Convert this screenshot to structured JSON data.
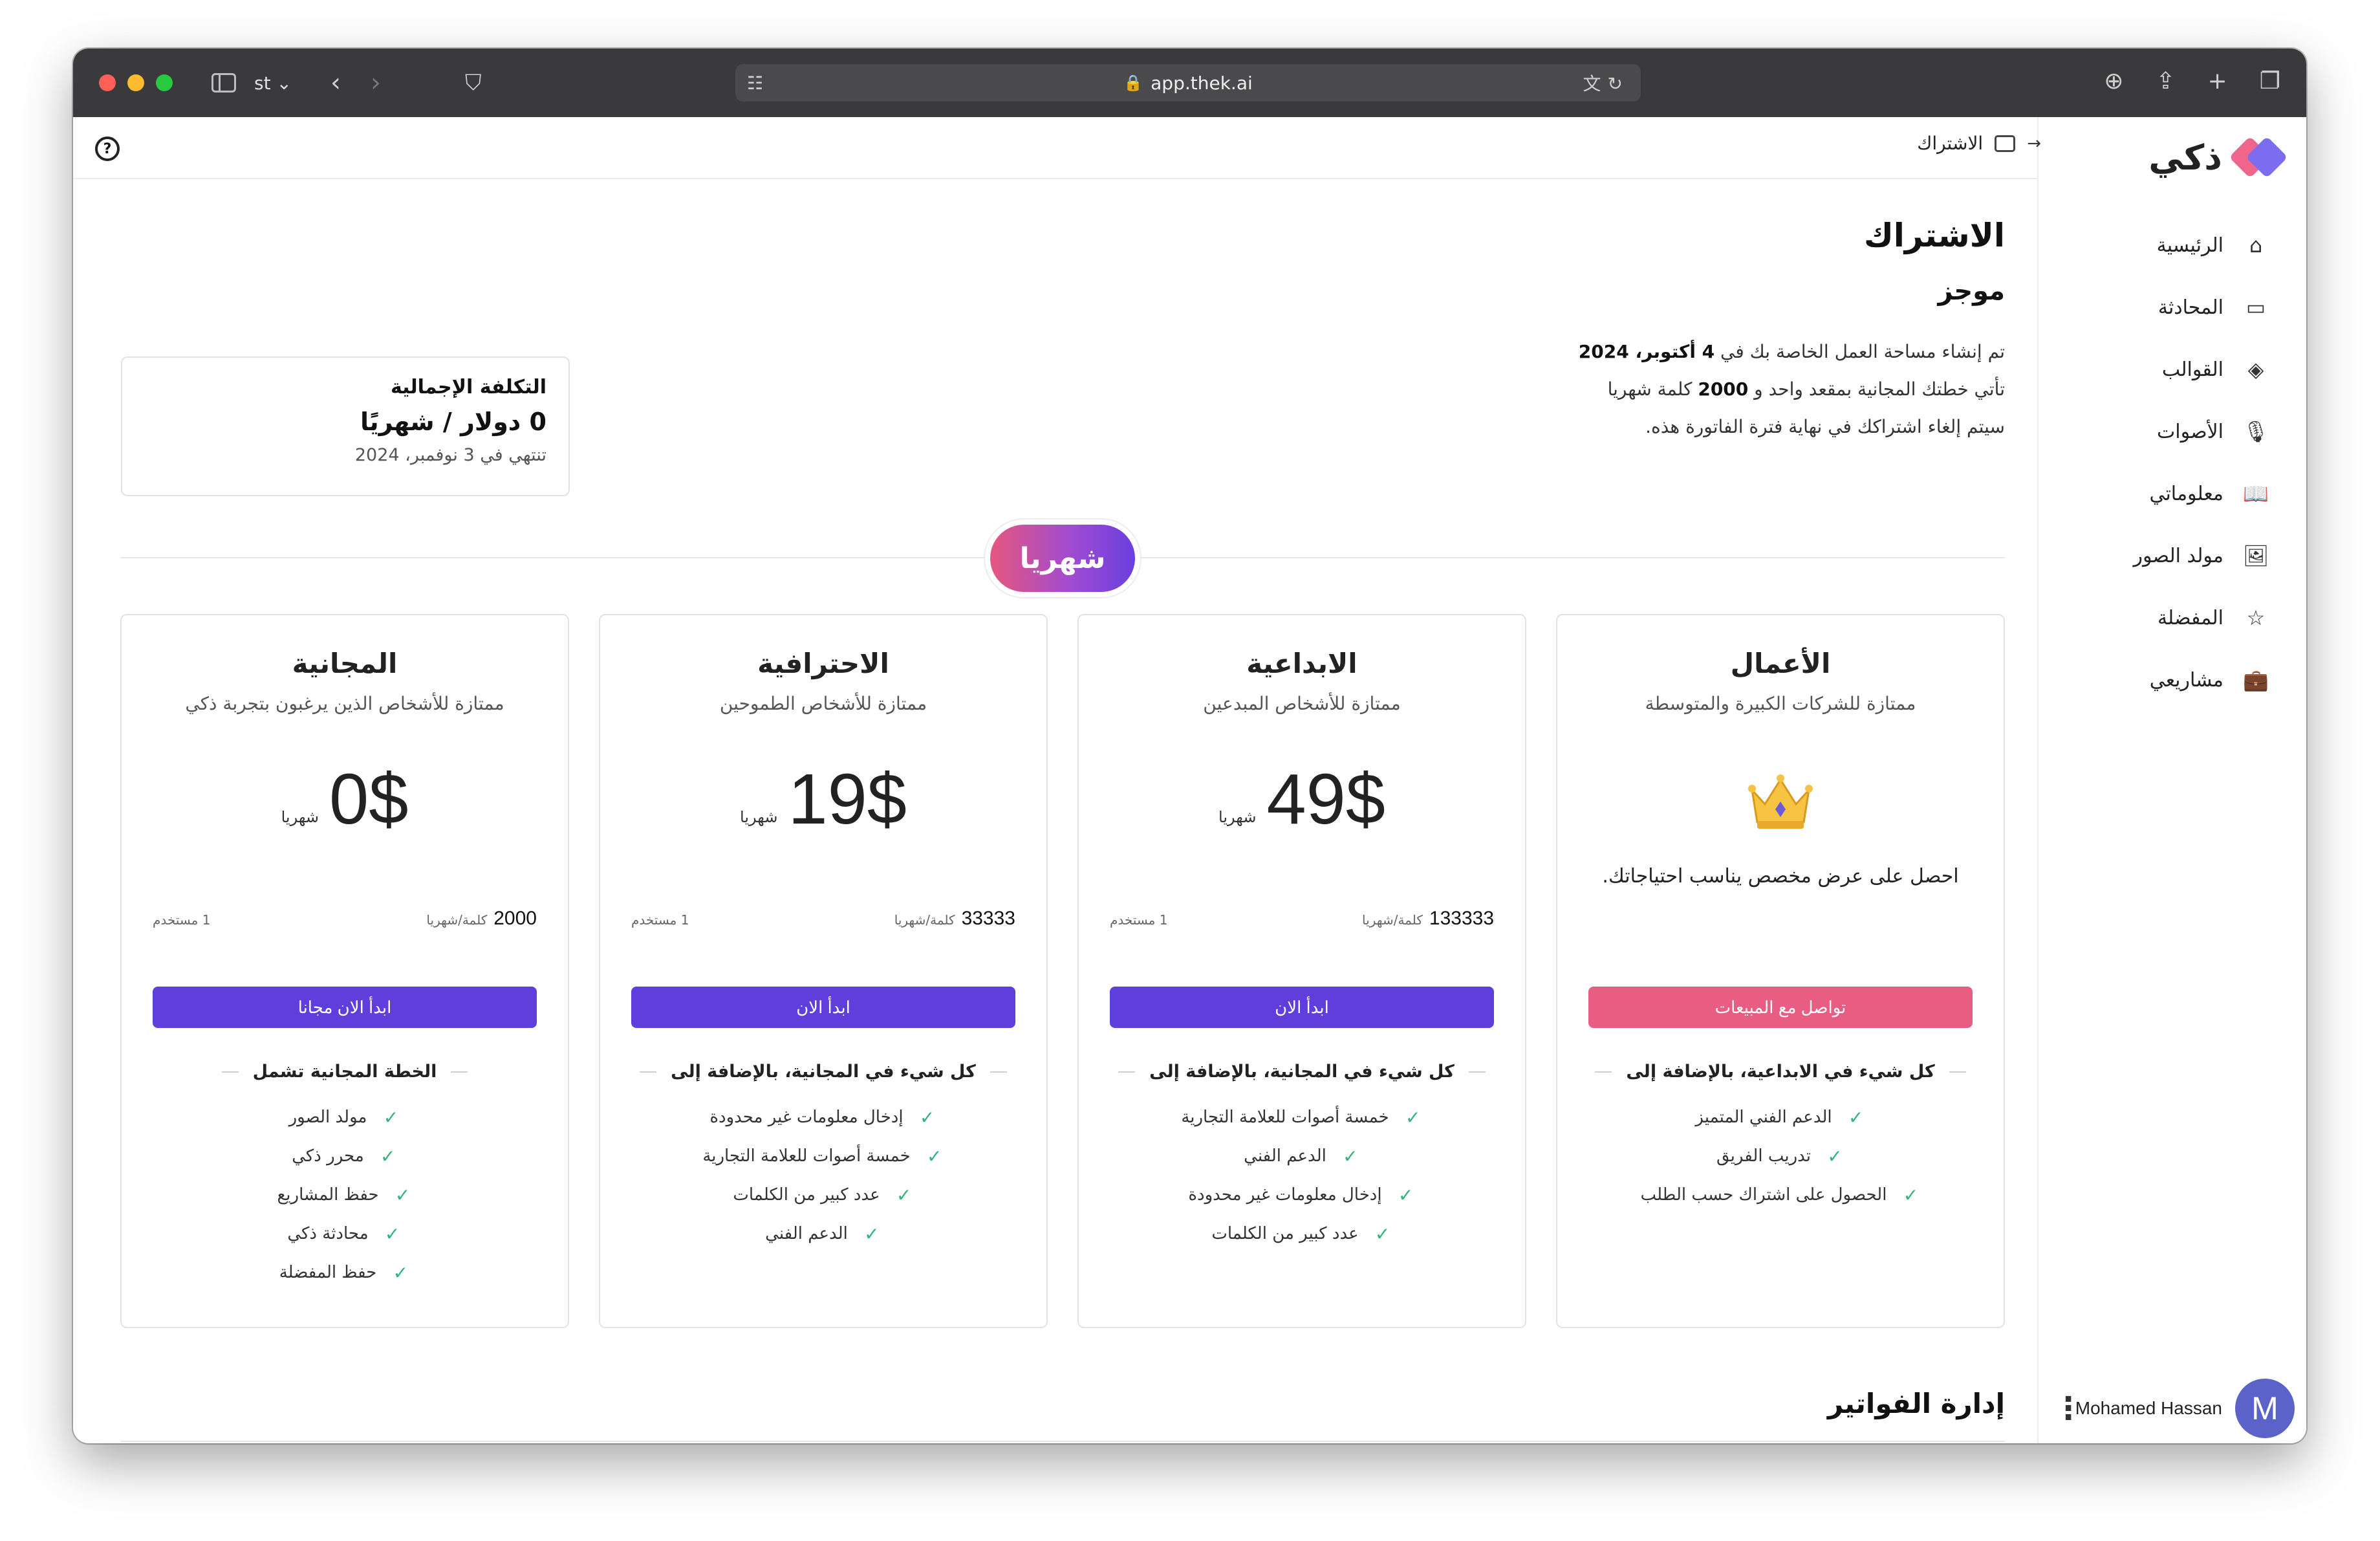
{
  "browser": {
    "tab_group": "st ⌄",
    "url": "app.thek.ai"
  },
  "app": {
    "logo_text": "ذكي",
    "breadcrumb": "الاشتراك",
    "nav": [
      {
        "label": "الرئيسية",
        "icon": "home-icon"
      },
      {
        "label": "المحادثة",
        "icon": "chat-icon"
      },
      {
        "label": "القوالب",
        "icon": "layers-icon"
      },
      {
        "label": "الأصوات",
        "icon": "microphone-icon"
      },
      {
        "label": "معلوماتي",
        "icon": "book-icon"
      },
      {
        "label": "مولد الصور",
        "icon": "image-icon"
      },
      {
        "label": "المفضلة",
        "icon": "star-icon"
      },
      {
        "label": "مشاريعي",
        "icon": "briefcase-icon"
      }
    ],
    "user": {
      "name": "Mohamed Hassan",
      "initial": "M"
    }
  },
  "page": {
    "title": "الاشتراك",
    "summary": {
      "title": "موجز",
      "line1_prefix": "تم إنشاء مساحة العمل الخاصة بك في ",
      "line1_bold": "4 أكتوبر، 2024",
      "line2_prefix": "تأتي خطتك المجانية بمقعد واحد و ",
      "line2_bold": "2000",
      "line2_suffix": " كلمة شهريا",
      "line3": "سيتم إلغاء اشتراكك في نهاية فترة الفاتورة هذه."
    },
    "cost": {
      "label": "التكلفة الإجمالية",
      "value": "0 دولار / شهريًا",
      "expiry": "تنتهي في 3 نوفمبر، 2024"
    },
    "period_toggle": "شهريا",
    "billing_title": "إدارة الفواتير"
  },
  "plans": [
    {
      "name": "الأعمال",
      "desc": "ممتازة للشركات الكبيرة والمتوسطة",
      "custom_offer": "احصل على عرض مخصص يناسب احتياجاتك.",
      "cta": "تواصل مع المبيعات",
      "features_head": "كل شيء في الابداعية، بالإضافة إلى",
      "features": [
        "الدعم الفني المتميز",
        "تدريب الفريق",
        "الحصول على اشتراك حسب الطلب"
      ]
    },
    {
      "name": "الابداعية",
      "desc": "ممتازة للأشخاص المبدعين",
      "price": "49$",
      "period": "شهريا",
      "words": "133333",
      "words_unit": "كلمة/شهريا",
      "users": "1 مستخدم",
      "cta": "ابدأ الان",
      "features_head": "كل شيء في المجانية، بالإضافة إلى",
      "features": [
        "خمسة أصوات للعلامة التجارية",
        "الدعم الفني",
        "إدخال معلومات غير محدودة",
        "عدد كبير من الكلمات"
      ]
    },
    {
      "name": "الاحترافية",
      "desc": "ممتازة للأشخاص الطموحين",
      "price": "19$",
      "period": "شهريا",
      "words": "33333",
      "words_unit": "كلمة/شهريا",
      "users": "1 مستخدم",
      "cta": "ابدأ الان",
      "features_head": "كل شيء في المجانية، بالإضافة إلى",
      "features": [
        "إدخال معلومات غير محدودة",
        "خمسة أصوات للعلامة التجارية",
        "عدد كبير من الكلمات",
        "الدعم الفني"
      ]
    },
    {
      "name": "المجانية",
      "desc": "ممتازة للأشخاص الذين يرغبون بتجربة ذكي",
      "price": "0$",
      "period": "شهريا",
      "words": "2000",
      "words_unit": "كلمة/شهريا",
      "users": "1 مستخدم",
      "cta": "ابدأ الان مجانا",
      "features_head": "الخطة المجانية تشمل",
      "features": [
        "مولد الصور",
        "محرر ذكي",
        "حفظ المشاريع",
        "محادثة ذكي",
        "حفظ المفضلة"
      ]
    }
  ],
  "colors": {
    "primary": "#5f3fdc",
    "sales": "#e85d82",
    "check": "#34b37a",
    "avatar": "#5b63c9"
  }
}
